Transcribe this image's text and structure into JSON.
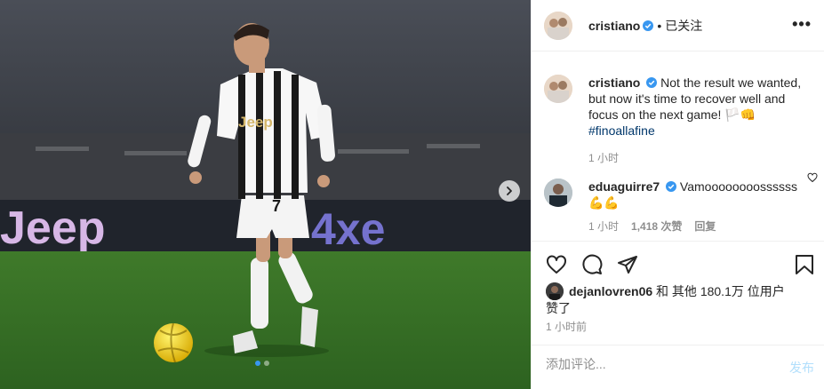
{
  "media": {
    "ad_board_text_1": "Jeep",
    "ad_board_text_2": "4xe",
    "shirt_text": "Jeep",
    "shirt_number": "7",
    "carousel_count": 2,
    "carousel_active_index": 0
  },
  "header": {
    "username": "cristiano",
    "separator": "•",
    "follow_status": "已关注",
    "more_label": "•••"
  },
  "caption": {
    "username": "cristiano",
    "text": "Not the result we wanted, but now it's time to recover well and focus on the next game! ",
    "emoji": "🏳️👊",
    "hashtag": "#finoallafine",
    "time": "1 小时"
  },
  "comment": {
    "username": "eduaguirre7",
    "text": "Vamoooooooossssss",
    "emoji": "💪💪",
    "time": "1 小时",
    "likes": "1,418 次赞",
    "reply": "回复"
  },
  "likes": {
    "user": "dejanlovren06",
    "text_1": " 和 其他 180.1万 位用户",
    "text_2": "赞了"
  },
  "timestamp": "1 小时前",
  "add_comment": {
    "placeholder": "添加评论...",
    "post_label": "发布"
  },
  "colors": {
    "verified": "#3897f0",
    "link": "#00376b",
    "post_disabled": "#b2dffc"
  }
}
